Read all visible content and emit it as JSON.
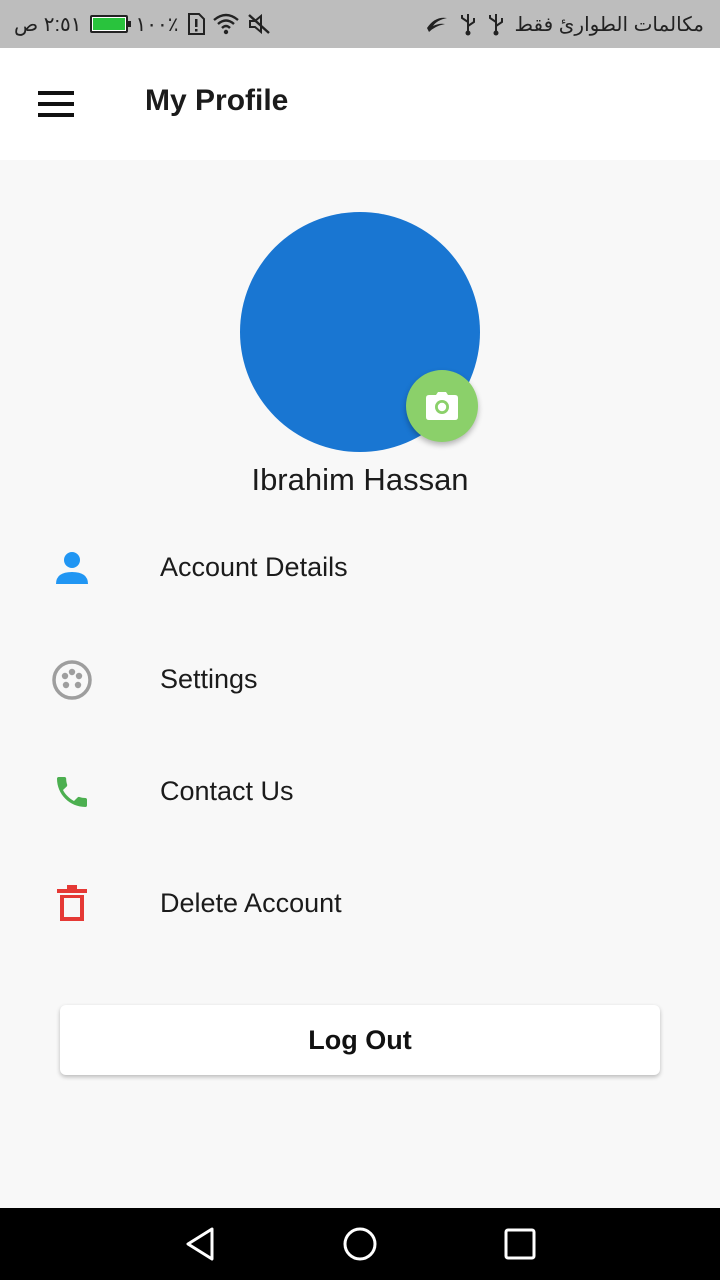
{
  "status_bar": {
    "time": "٢:٥١ ص",
    "battery_percent": "١٠٠٪",
    "carrier": "مكالمات الطوارئ فقط",
    "colors": {
      "background": "#bdbdbd",
      "battery_fill": "#29c33d"
    }
  },
  "app_bar": {
    "title": "My Profile",
    "menu_icon": "hamburger-menu-icon"
  },
  "profile": {
    "name": "Ibrahim Hassan",
    "avatar_color": "#1976d2",
    "camera_button_color": "#8bd06a",
    "camera_icon": "camera-icon"
  },
  "menu": {
    "items": [
      {
        "label": "Account Details",
        "icon": "person-icon",
        "icon_color": "#2196f3"
      },
      {
        "label": "Settings",
        "icon": "settings-icon",
        "icon_color": "#9e9e9e"
      },
      {
        "label": "Contact Us",
        "icon": "phone-icon",
        "icon_color": "#4caf50"
      },
      {
        "label": "Delete Account",
        "icon": "trash-icon",
        "icon_color": "#e53935"
      }
    ]
  },
  "logout": {
    "label": "Log Out"
  },
  "nav_bar": {
    "back_icon": "back-triangle-icon",
    "home_icon": "home-circle-icon",
    "recents_icon": "recents-square-icon"
  }
}
